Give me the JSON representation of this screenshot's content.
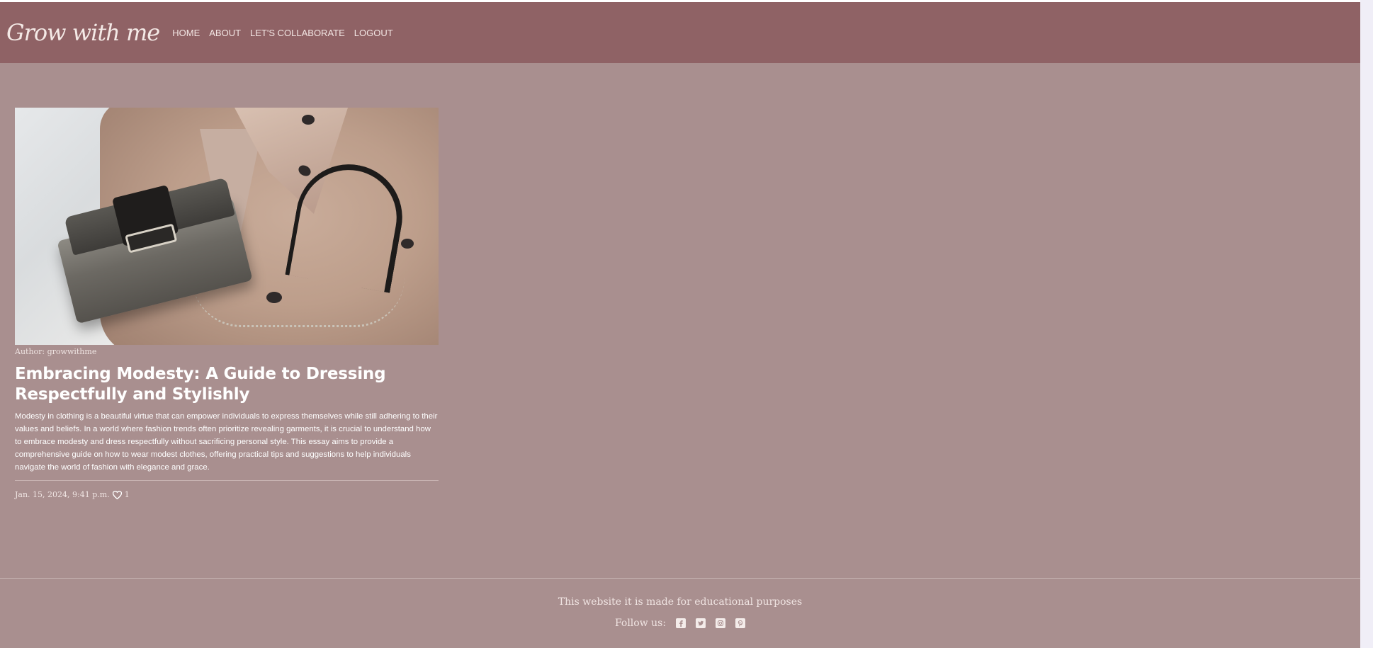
{
  "brand": {
    "name": "Grow with me"
  },
  "nav": {
    "items": [
      {
        "label": "HOME"
      },
      {
        "label": "ABOUT"
      },
      {
        "label": "LET'S COLLABORATE"
      },
      {
        "label": "LOGOUT"
      }
    ]
  },
  "post": {
    "author": "Author: growwithme",
    "title": "Embracing Modesty: A Guide to Dressing Respectfully and Stylishly",
    "excerpt": "Modesty in clothing is a beautiful virtue that can empower individuals to express themselves while still adhering to their values and beliefs. In a world where fashion trends often prioritize revealing garments, it is crucial to understand how to embrace modesty and dress respectfully without sacrificing personal style. This essay aims to provide a comprehensive guide on how to wear modest clothes, offering practical tips and suggestions to help individuals navigate the world of fashion with elegance and grace.",
    "date": "Jan. 15, 2024, 9:41 p.m.",
    "likes": "1",
    "image_icon": "handbag-on-trench-coat-photo"
  },
  "footer": {
    "text": "This website it is made for educational purposes",
    "follow_label": "Follow us:",
    "social": [
      {
        "icon": "facebook-icon"
      },
      {
        "icon": "twitter-icon"
      },
      {
        "icon": "instagram-icon"
      },
      {
        "icon": "pinterest-icon"
      }
    ]
  },
  "colors": {
    "navbar": "#8f6265",
    "page_background": "#a98f8f",
    "text_light": "#ffffff"
  }
}
